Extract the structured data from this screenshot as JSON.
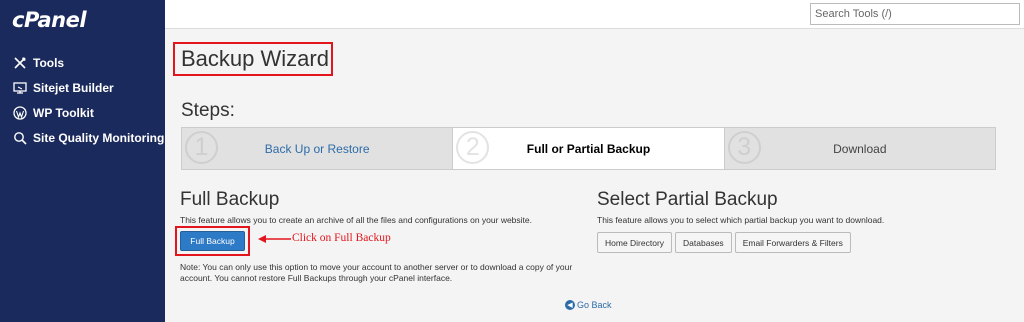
{
  "sidebar": {
    "logo": "cPanel",
    "items": [
      {
        "label": "Tools",
        "icon": "tools-icon"
      },
      {
        "label": "Sitejet Builder",
        "icon": "monitor-icon"
      },
      {
        "label": "WP Toolkit",
        "icon": "wordpress-icon"
      },
      {
        "label": "Site Quality Monitoring",
        "icon": "search-icon"
      }
    ]
  },
  "topbar": {
    "search_placeholder": "Search Tools (/)"
  },
  "main": {
    "title": "Backup Wizard",
    "steps_heading": "Steps:",
    "steps": [
      {
        "num": "1",
        "label": "Back Up or Restore"
      },
      {
        "num": "2",
        "label": "Full or Partial Backup"
      },
      {
        "num": "3",
        "label": "Download"
      }
    ],
    "full_backup": {
      "heading": "Full Backup",
      "description": "This feature allows you to create an archive of all the files and configurations on your website.",
      "button_label": "Full Backup",
      "note": "Note: You can only use this option to move your account to another server or to download a copy of your account. You cannot restore Full Backups through your cPanel interface."
    },
    "partial_backup": {
      "heading": "Select Partial Backup",
      "description": "This feature allows you to select which partial backup you want to download.",
      "buttons": [
        "Home Directory",
        "Databases",
        "Email Forwarders & Filters"
      ]
    },
    "go_back": "Go Back"
  },
  "annotation": {
    "text": "Click on Full Backup",
    "color": "#e3151c"
  },
  "colors": {
    "sidebar_bg": "#1b2a5c",
    "primary": "#2d7ac6",
    "link": "#2d6ca8",
    "highlight": "#e3151c"
  }
}
